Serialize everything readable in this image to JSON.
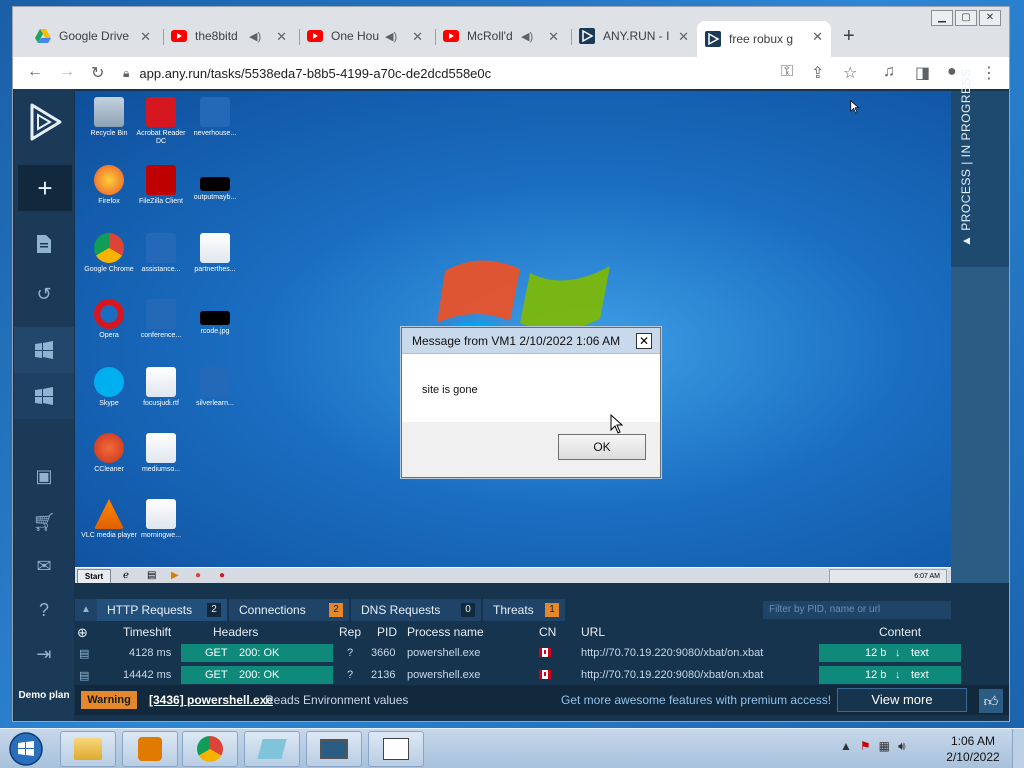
{
  "browser": {
    "tabs": [
      {
        "label": "Google Drive",
        "icon": "google-drive-icon",
        "sound": false
      },
      {
        "label": "the8bitd",
        "icon": "youtube-icon",
        "sound": true
      },
      {
        "label": "One Hou",
        "icon": "youtube-icon",
        "sound": true
      },
      {
        "label": "McRoll'd",
        "icon": "youtube-icon",
        "sound": true
      },
      {
        "label": "ANY.RUN - I",
        "icon": "anyrun-icon",
        "sound": false
      },
      {
        "label": "free robux g",
        "icon": "anyrun-icon",
        "sound": false
      }
    ],
    "url": "app.any.run/tasks/5538eda7-b8b5-4199-a70c-de2dcd558e0c"
  },
  "sidebar": {
    "demo_label": "Demo plan"
  },
  "vm": {
    "desktop_icons": [
      {
        "label": "Recycle Bin"
      },
      {
        "label": "Acrobat Reader DC"
      },
      {
        "label": "neverhouse..."
      },
      {
        "label": "Firefox"
      },
      {
        "label": "FileZilla Client"
      },
      {
        "label": "outputmayb..."
      },
      {
        "label": "Google Chrome"
      },
      {
        "label": "assistance..."
      },
      {
        "label": "partnerthes..."
      },
      {
        "label": "Opera"
      },
      {
        "label": "conference..."
      },
      {
        "label": "rcode.jpg"
      },
      {
        "label": "Skype"
      },
      {
        "label": "focusjudi.rtf"
      },
      {
        "label": "silverlearn..."
      },
      {
        "label": "CCleaner"
      },
      {
        "label": "mediumso..."
      },
      {
        "label": "VLC media player"
      },
      {
        "label": "morningwe..."
      }
    ],
    "start_label": "Start",
    "clock": "6:07 AM",
    "msgbox": {
      "title": "Message from VM1 2/10/2022 1:06 AM",
      "message": "site is gone",
      "ok_label": "OK"
    }
  },
  "process_panel": {
    "label": "PROCESS | IN PROGRESS"
  },
  "network": {
    "tabs": [
      {
        "label": "HTTP Requests",
        "count": "2"
      },
      {
        "label": "Connections",
        "count": "2"
      },
      {
        "label": "DNS Requests",
        "count": "0"
      },
      {
        "label": "Threats",
        "count": "1"
      }
    ],
    "filter_placeholder": "Filter by PID, name or url",
    "columns": {
      "timeshift": "Timeshift",
      "headers": "Headers",
      "rep": "Rep",
      "pid": "PID",
      "process": "Process name",
      "cn": "CN",
      "url": "URL",
      "content": "Content"
    },
    "rows": [
      {
        "timeshift": "4128 ms",
        "method": "GET",
        "status": "200: OK",
        "rep": "?",
        "pid": "3660",
        "process": "powershell.exe",
        "url": "http://70.70.19.220:9080/xbat/on.xbat",
        "size": "12 b",
        "type": "text"
      },
      {
        "timeshift": "14442 ms",
        "method": "GET",
        "status": "200: OK",
        "rep": "?",
        "pid": "2136",
        "process": "powershell.exe",
        "url": "http://70.70.19.220:9080/xbat/on.xbat",
        "size": "12 b",
        "type": "text"
      }
    ]
  },
  "footer": {
    "warning_label": "Warning",
    "warning_process": "[3436] powershell.exe",
    "warning_message": "Reads Environment values",
    "premium_text": "Get more awesome features with premium access!",
    "view_more": "View more"
  },
  "taskbar": {
    "time": "1:06 AM",
    "date": "2/10/2022"
  },
  "colors": {
    "anyrun_dark": "#17344f",
    "accent_teal": "#0f8a7a",
    "warning_orange": "#e3892c"
  }
}
